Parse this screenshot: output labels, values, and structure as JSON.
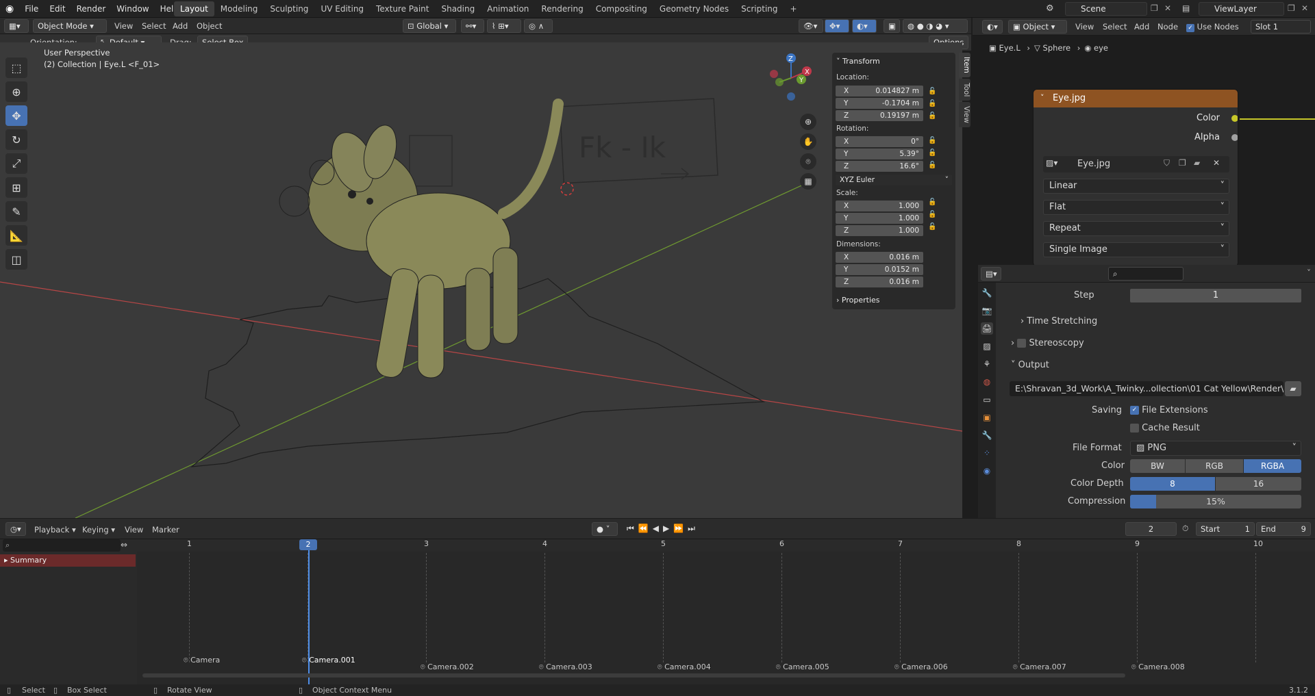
{
  "topbar": {
    "menus": [
      "File",
      "Edit",
      "Render",
      "Window",
      "Help"
    ],
    "workspaces": [
      "Layout",
      "Modeling",
      "Sculpting",
      "UV Editing",
      "Texture Paint",
      "Shading",
      "Animation",
      "Rendering",
      "Compositing",
      "Geometry Nodes",
      "Scripting"
    ],
    "active_workspace": "Layout",
    "add_tab": "+",
    "scene": "Scene",
    "view_layer": "ViewLayer"
  },
  "viewport": {
    "mode": "Object Mode",
    "menus": [
      "View",
      "Select",
      "Add",
      "Object"
    ],
    "transform_orientation": "Global",
    "orientation_label": "Orientation:",
    "orientation_value": "Default",
    "drag_label": "Drag:",
    "drag_value": "Select Box",
    "options": "Options",
    "view_name": "User Perspective",
    "collection_info": "(2) Collection | Eye.L <F_01>",
    "board_text": "Fk  -  Ik"
  },
  "npanel": {
    "tabs": [
      "Item",
      "Tool",
      "View"
    ],
    "transform_title": "Transform",
    "location_label": "Location:",
    "location": {
      "x": "0.014827 m",
      "y": "-0.1704 m",
      "z": "0.19197 m"
    },
    "rotation_label": "Rotation:",
    "rotation": {
      "x": "0°",
      "y": "5.39°",
      "z": "16.6°"
    },
    "rotation_mode": "XYZ Euler",
    "scale_label": "Scale:",
    "scale": {
      "x": "1.000",
      "y": "1.000",
      "z": "1.000"
    },
    "dimensions_label": "Dimensions:",
    "dimensions": {
      "x": "0.016 m",
      "y": "0.0152 m",
      "z": "0.016 m"
    },
    "properties_title": "Properties",
    "axis_x": "X",
    "axis_y": "Y",
    "axis_z": "Z"
  },
  "node_editor": {
    "type": "Object",
    "menus": [
      "View",
      "Select",
      "Add",
      "Node"
    ],
    "use_nodes": "Use Nodes",
    "slot": "Slot 1",
    "breadcrumb": [
      "Eye.L",
      "Sphere",
      "eye"
    ],
    "node_title": "Eye.jpg",
    "outputs": [
      "Color",
      "Alpha"
    ],
    "image_name": "Eye.jpg",
    "interpolation": "Linear",
    "projection": "Flat",
    "extension": "Repeat",
    "source": "Single Image"
  },
  "properties": {
    "step_label": "Step",
    "step_value": "1",
    "time_stretching": "Time Stretching",
    "stereoscopy": "Stereoscopy",
    "output_title": "Output",
    "output_path": "E:\\Shravan_3d_Work\\A_Twinky...ollection\\01 Cat Yellow\\Render\\",
    "saving_label": "Saving",
    "file_extensions": "File Extensions",
    "cache_result": "Cache Result",
    "file_format_label": "File Format",
    "file_format": "PNG",
    "color_label": "Color",
    "color_options": [
      "BW",
      "RGB",
      "RGBA"
    ],
    "color_selected": "RGBA",
    "color_depth_label": "Color Depth",
    "color_depth_options": [
      "8",
      "16"
    ],
    "color_depth_selected": "8",
    "compression_label": "Compression",
    "compression": "15%",
    "compression_fraction": 0.15
  },
  "timeline": {
    "menus": [
      "Playback",
      "Keying",
      "View",
      "Marker"
    ],
    "current_frame": "2",
    "start_label": "Start",
    "start": "1",
    "end_label": "End",
    "end": "9",
    "summary": "Summary",
    "frames": [
      "1",
      "2",
      "3",
      "4",
      "5",
      "6",
      "7",
      "8",
      "9",
      "10"
    ],
    "cameras": [
      "Camera",
      "Camera.001",
      "Camera.002",
      "Camera.003",
      "Camera.004",
      "Camera.005",
      "Camera.006",
      "Camera.007",
      "Camera.008"
    ]
  },
  "statusbar": {
    "select": "Select",
    "box_select": "Box Select",
    "rotate_view": "Rotate View",
    "context_menu": "Object Context Menu",
    "version": "3.1.2"
  }
}
